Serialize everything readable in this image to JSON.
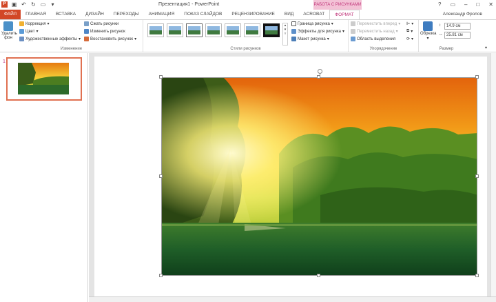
{
  "window": {
    "title": "Презентация1 - PowerPoint",
    "contextual_header": "РАБОТА С РИСУНКАМИ",
    "help": "?",
    "user": "Александр Фролов"
  },
  "tabs": [
    "ФАЙЛ",
    "ГЛАВНАЯ",
    "ВСТАВКА",
    "ДИЗАЙН",
    "ПЕРЕХОДЫ",
    "АНИМАЦИЯ",
    "ПОКАЗ СЛАЙДОВ",
    "РЕЦЕНЗИРОВАНИЕ",
    "ВИД",
    "ACROBAT",
    "ФОРМАТ"
  ],
  "ribbon": {
    "adjust": {
      "remove_bg_line1": "Удалить",
      "remove_bg_line2": "фон",
      "corrections": "Коррекция",
      "color": "Цвет",
      "artistic": "Художественные эффекты",
      "compress": "Сжать рисунки",
      "change": "Изменить рисунок",
      "reset": "Восстановить рисунок",
      "label": "Изменение"
    },
    "styles": {
      "label": "Стили рисунков",
      "border": "Граница рисунка",
      "effects": "Эффекты для рисунка",
      "layout": "Макет рисунка"
    },
    "arrange": {
      "forward": "Переместить вперед",
      "backward": "Переместить назад",
      "selection": "Область выделения",
      "label": "Упорядочение"
    },
    "size": {
      "crop": "Обрезка",
      "height": "14.9 см",
      "width": "25.81 см",
      "label": "Размер"
    }
  },
  "slides": {
    "number": "1"
  },
  "colors": {
    "accent": "#d24726",
    "context": "#c0357a"
  }
}
